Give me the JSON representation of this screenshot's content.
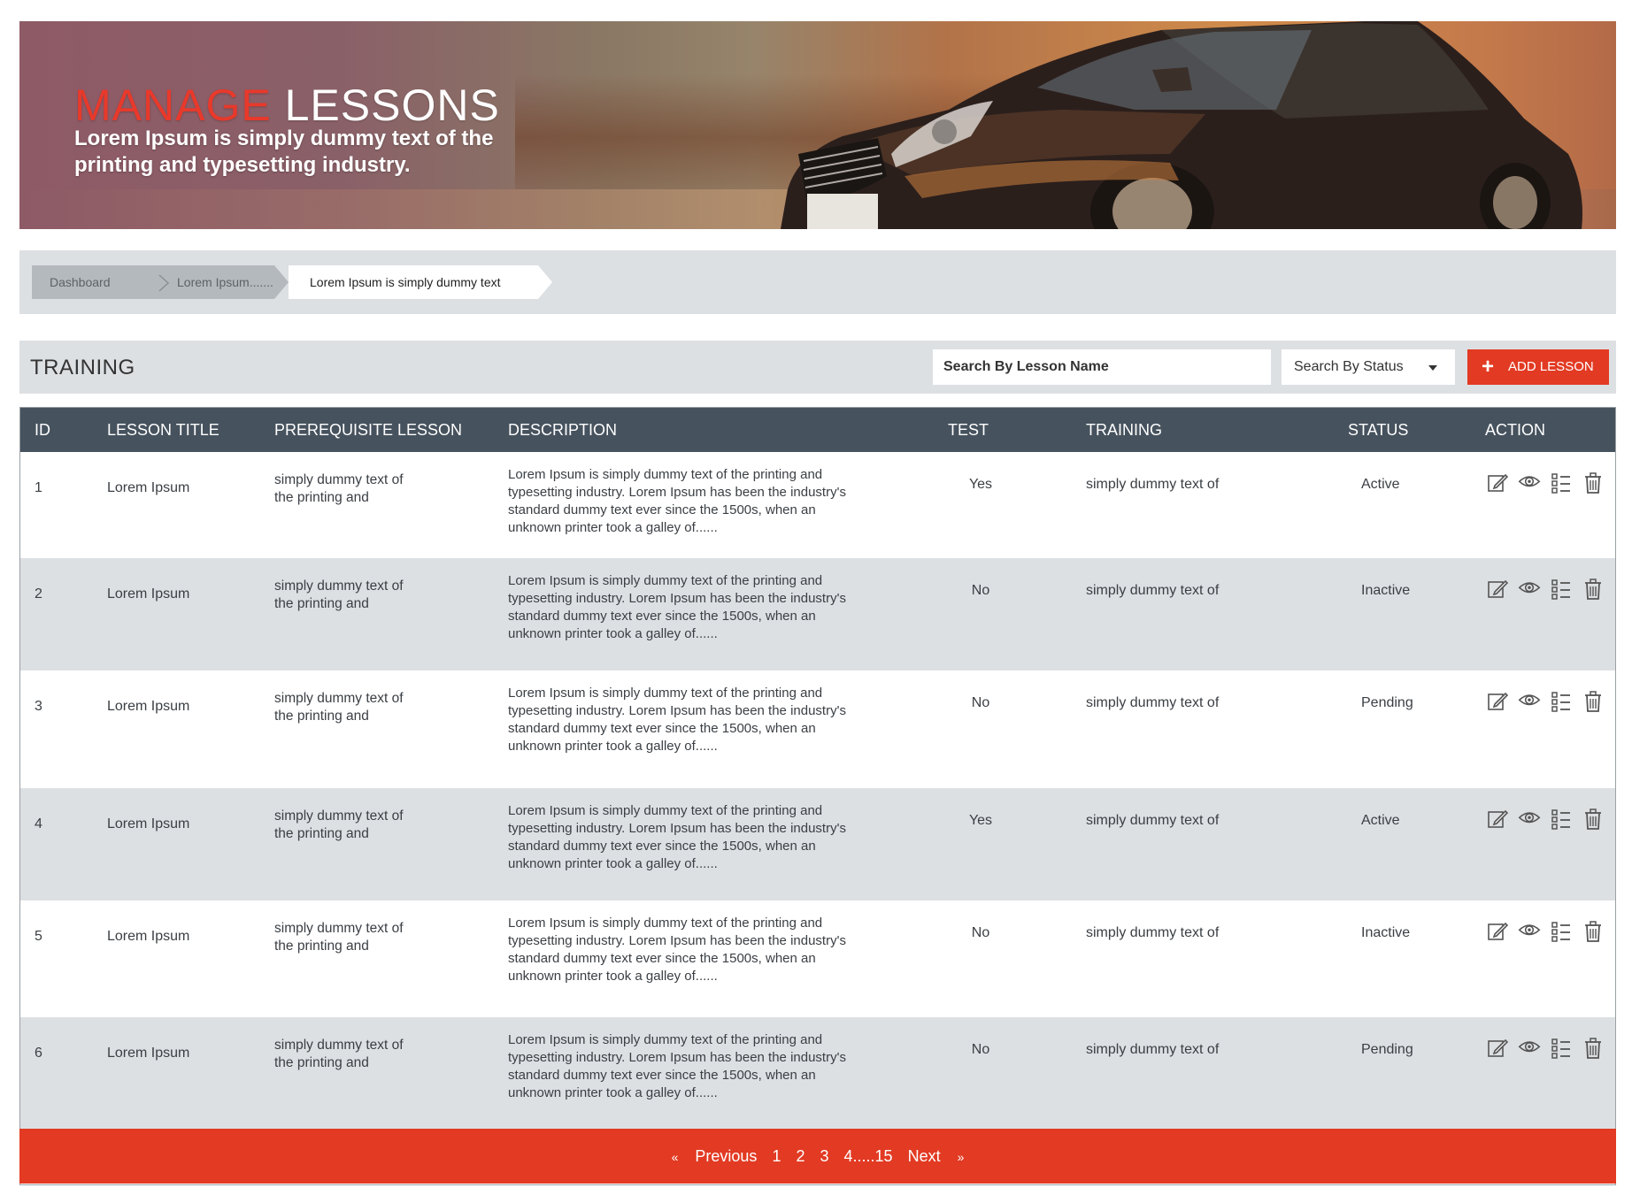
{
  "banner": {
    "title_accent": "MANAGE",
    "title_rest": "LESSONS",
    "subtitle": "Lorem Ipsum is simply dummy text of the printing and typesetting industry."
  },
  "breadcrumb": {
    "items": [
      "Dashboard",
      "Lorem Ipsum.......",
      "Lorem Ipsum is simply dummy text"
    ]
  },
  "toolbar": {
    "section_title": "TRAINING",
    "search_placeholder": "Search By Lesson Name",
    "status_label": "Search By Status",
    "add_label": "ADD LESSON"
  },
  "table": {
    "columns": [
      "ID",
      "LESSON TITLE",
      "PREREQUISITE LESSON",
      "DESCRIPTION",
      "TEST",
      "TRAINING",
      "STATUS",
      "ACTION"
    ],
    "rows": [
      {
        "id": "1",
        "title": "Lorem Ipsum",
        "prereq": "simply dummy text of the printing and",
        "description": "Lorem Ipsum is simply dummy text of the printing and typesetting industry. Lorem Ipsum has been the industry's standard dummy text ever since the 1500s, when an unknown printer took a galley of......",
        "test": "Yes",
        "training": "simply dummy text of",
        "status": "Active"
      },
      {
        "id": "2",
        "title": "Lorem Ipsum",
        "prereq": "simply dummy text of the printing and",
        "description": "Lorem Ipsum is simply dummy text of the printing and typesetting industry. Lorem Ipsum has been the industry's standard dummy text ever since the 1500s, when an unknown printer took a galley of......",
        "test": "No",
        "training": "simply dummy text of",
        "status": "Inactive"
      },
      {
        "id": "3",
        "title": "Lorem Ipsum",
        "prereq": "simply dummy text of the printing and",
        "description": "Lorem Ipsum is simply dummy text of the printing and typesetting industry. Lorem Ipsum has been the industry's standard dummy text ever since the 1500s, when an unknown printer took a galley of......",
        "test": "No",
        "training": "simply dummy text of",
        "status": "Pending"
      },
      {
        "id": "4",
        "title": "Lorem Ipsum",
        "prereq": "simply dummy text of the printing and",
        "description": "Lorem Ipsum is simply dummy text of the printing and typesetting industry. Lorem Ipsum has been the industry's standard dummy text ever since the 1500s, when an unknown printer took a galley of......",
        "test": "Yes",
        "training": "simply dummy text of",
        "status": "Active"
      },
      {
        "id": "5",
        "title": "Lorem Ipsum",
        "prereq": "simply dummy text of the printing and",
        "description": "Lorem Ipsum is simply dummy text of the printing and typesetting industry. Lorem Ipsum has been the industry's standard dummy text ever since the 1500s, when an unknown printer took a galley of......",
        "test": "No",
        "training": "simply dummy text of",
        "status": "Inactive"
      },
      {
        "id": "6",
        "title": "Lorem Ipsum",
        "prereq": "simply dummy text of the printing and",
        "description": "Lorem Ipsum is simply dummy text of the printing and typesetting industry. Lorem Ipsum has been the industry's standard dummy text ever since the 1500s, when an unknown printer took a galley of......",
        "test": "No",
        "training": "simply dummy text of",
        "status": "Pending"
      }
    ],
    "action_icons": [
      "edit-icon",
      "view-icon",
      "checklist-icon",
      "delete-icon"
    ]
  },
  "pagination": {
    "first_arrow": "«",
    "previous": "Previous",
    "pages": [
      "1",
      "2",
      "3",
      "4.....15"
    ],
    "next": "Next",
    "last_arrow": "»"
  },
  "colors": {
    "accent": "#e23a23",
    "header_bg": "#46525d",
    "stripe": "#dde0e3"
  }
}
